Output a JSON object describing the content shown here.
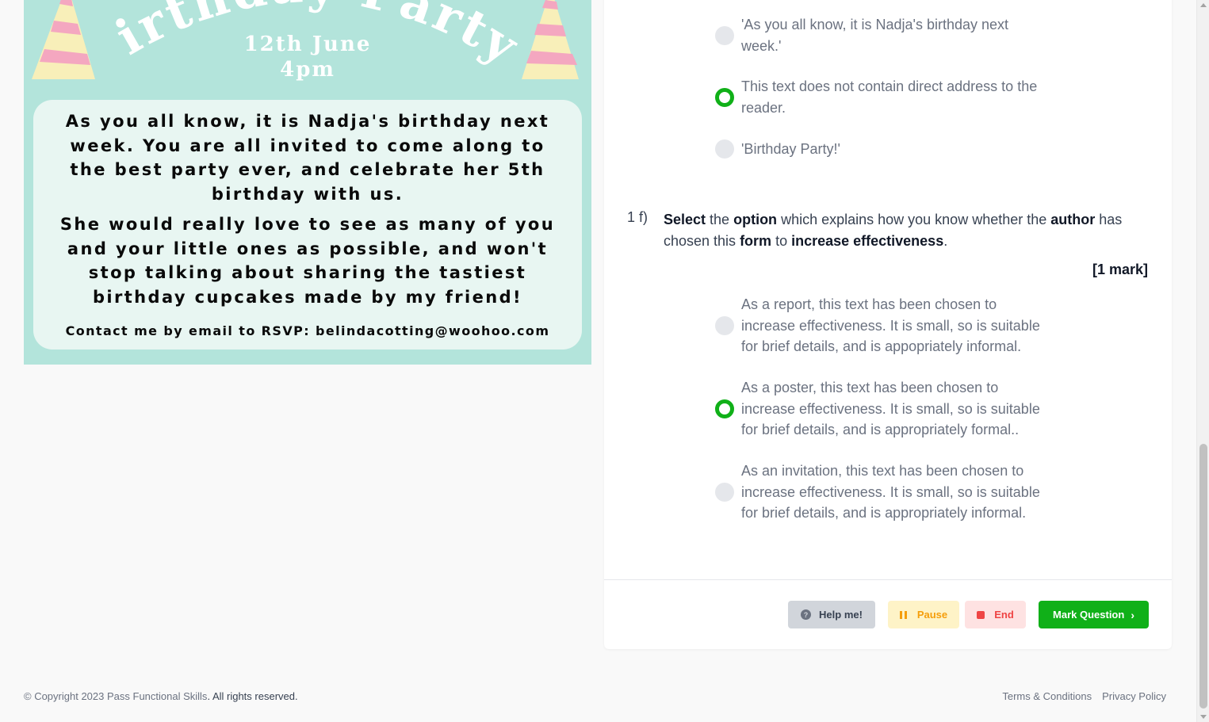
{
  "poster": {
    "title": "Birthday Party!",
    "date": "12th June",
    "time": "4pm",
    "paragraph1": "As you all know, it is Nadja's birthday next week. You are all invited to come along to the best party ever, and celebrate her 5th birthday with us.",
    "paragraph2": "She would really love to see as many of you and your little ones as possible, and won't stop talking about sharing the tastiest birthday cupcakes made by my friend!",
    "contact": "Contact me by email to RSVP: belindacotting@woohoo.com",
    "colors": {
      "background": "#b3e4db",
      "card": "#e8f6f2",
      "hat_stripe_pink": "#f4a7c0",
      "hat_stripe_cream": "#f8efb9"
    }
  },
  "prev_question": {
    "options": [
      {
        "label": "'As you all know, it is Nadja's birthday next week.'",
        "selected": false
      },
      {
        "label": "This text does not contain direct address to the reader.",
        "selected": true
      },
      {
        "label": "'Birthday Party!'",
        "selected": false
      }
    ]
  },
  "question": {
    "number": "1 f)",
    "text_parts": [
      "Select",
      " the ",
      "option",
      " which explains how you know whether the ",
      "author",
      " has chosen this ",
      "form",
      " to ",
      "increase effectiveness",
      "."
    ],
    "marks": "[1 mark]",
    "options": [
      {
        "label": "As a report, this text has been chosen to increase effectiveness. It is small, so is suitable for brief details, and is appopriately informal.",
        "selected": false
      },
      {
        "label": "As a poster, this text has been chosen to increase effectiveness. It is small, so is suitable for brief details, and is appropriately formal..",
        "selected": true
      },
      {
        "label": "As an invitation, this text has been chosen to increase effectiveness. It is small, so is suitable for brief details, and is appropriately informal.",
        "selected": false
      }
    ]
  },
  "actions": {
    "help": "Help me!",
    "pause": "Pause",
    "end": "End",
    "mark": "Mark Question"
  },
  "footer": {
    "copyright": "© Copyright 2023 ",
    "brand": "Pass Functional Skills",
    "rights": ". All rights reserved.",
    "terms": "Terms & Conditions",
    "privacy": "Privacy Policy"
  },
  "colors": {
    "accent_green": "#10b018",
    "pause_bg": "#fef3c7",
    "end_bg": "#fee2e2"
  },
  "icons": [
    "question-circle-icon",
    "pause-icon",
    "stop-icon",
    "chevron-right-icon"
  ]
}
